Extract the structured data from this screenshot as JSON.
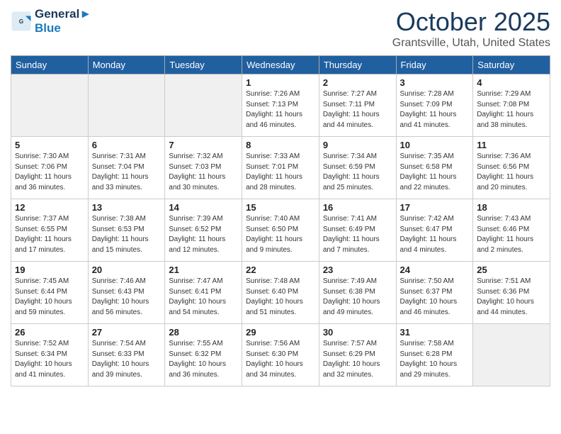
{
  "header": {
    "logo_line1": "General",
    "logo_line2": "Blue",
    "month": "October 2025",
    "location": "Grantsville, Utah, United States"
  },
  "weekdays": [
    "Sunday",
    "Monday",
    "Tuesday",
    "Wednesday",
    "Thursday",
    "Friday",
    "Saturday"
  ],
  "weeks": [
    [
      {
        "day": "",
        "info": "",
        "empty": true
      },
      {
        "day": "",
        "info": "",
        "empty": true
      },
      {
        "day": "",
        "info": "",
        "empty": true
      },
      {
        "day": "1",
        "info": "Sunrise: 7:26 AM\nSunset: 7:13 PM\nDaylight: 11 hours\nand 46 minutes.",
        "empty": false
      },
      {
        "day": "2",
        "info": "Sunrise: 7:27 AM\nSunset: 7:11 PM\nDaylight: 11 hours\nand 44 minutes.",
        "empty": false
      },
      {
        "day": "3",
        "info": "Sunrise: 7:28 AM\nSunset: 7:09 PM\nDaylight: 11 hours\nand 41 minutes.",
        "empty": false
      },
      {
        "day": "4",
        "info": "Sunrise: 7:29 AM\nSunset: 7:08 PM\nDaylight: 11 hours\nand 38 minutes.",
        "empty": false
      }
    ],
    [
      {
        "day": "5",
        "info": "Sunrise: 7:30 AM\nSunset: 7:06 PM\nDaylight: 11 hours\nand 36 minutes.",
        "empty": false
      },
      {
        "day": "6",
        "info": "Sunrise: 7:31 AM\nSunset: 7:04 PM\nDaylight: 11 hours\nand 33 minutes.",
        "empty": false
      },
      {
        "day": "7",
        "info": "Sunrise: 7:32 AM\nSunset: 7:03 PM\nDaylight: 11 hours\nand 30 minutes.",
        "empty": false
      },
      {
        "day": "8",
        "info": "Sunrise: 7:33 AM\nSunset: 7:01 PM\nDaylight: 11 hours\nand 28 minutes.",
        "empty": false
      },
      {
        "day": "9",
        "info": "Sunrise: 7:34 AM\nSunset: 6:59 PM\nDaylight: 11 hours\nand 25 minutes.",
        "empty": false
      },
      {
        "day": "10",
        "info": "Sunrise: 7:35 AM\nSunset: 6:58 PM\nDaylight: 11 hours\nand 22 minutes.",
        "empty": false
      },
      {
        "day": "11",
        "info": "Sunrise: 7:36 AM\nSunset: 6:56 PM\nDaylight: 11 hours\nand 20 minutes.",
        "empty": false
      }
    ],
    [
      {
        "day": "12",
        "info": "Sunrise: 7:37 AM\nSunset: 6:55 PM\nDaylight: 11 hours\nand 17 minutes.",
        "empty": false
      },
      {
        "day": "13",
        "info": "Sunrise: 7:38 AM\nSunset: 6:53 PM\nDaylight: 11 hours\nand 15 minutes.",
        "empty": false
      },
      {
        "day": "14",
        "info": "Sunrise: 7:39 AM\nSunset: 6:52 PM\nDaylight: 11 hours\nand 12 minutes.",
        "empty": false
      },
      {
        "day": "15",
        "info": "Sunrise: 7:40 AM\nSunset: 6:50 PM\nDaylight: 11 hours\nand 9 minutes.",
        "empty": false
      },
      {
        "day": "16",
        "info": "Sunrise: 7:41 AM\nSunset: 6:49 PM\nDaylight: 11 hours\nand 7 minutes.",
        "empty": false
      },
      {
        "day": "17",
        "info": "Sunrise: 7:42 AM\nSunset: 6:47 PM\nDaylight: 11 hours\nand 4 minutes.",
        "empty": false
      },
      {
        "day": "18",
        "info": "Sunrise: 7:43 AM\nSunset: 6:46 PM\nDaylight: 11 hours\nand 2 minutes.",
        "empty": false
      }
    ],
    [
      {
        "day": "19",
        "info": "Sunrise: 7:45 AM\nSunset: 6:44 PM\nDaylight: 10 hours\nand 59 minutes.",
        "empty": false
      },
      {
        "day": "20",
        "info": "Sunrise: 7:46 AM\nSunset: 6:43 PM\nDaylight: 10 hours\nand 56 minutes.",
        "empty": false
      },
      {
        "day": "21",
        "info": "Sunrise: 7:47 AM\nSunset: 6:41 PM\nDaylight: 10 hours\nand 54 minutes.",
        "empty": false
      },
      {
        "day": "22",
        "info": "Sunrise: 7:48 AM\nSunset: 6:40 PM\nDaylight: 10 hours\nand 51 minutes.",
        "empty": false
      },
      {
        "day": "23",
        "info": "Sunrise: 7:49 AM\nSunset: 6:38 PM\nDaylight: 10 hours\nand 49 minutes.",
        "empty": false
      },
      {
        "day": "24",
        "info": "Sunrise: 7:50 AM\nSunset: 6:37 PM\nDaylight: 10 hours\nand 46 minutes.",
        "empty": false
      },
      {
        "day": "25",
        "info": "Sunrise: 7:51 AM\nSunset: 6:36 PM\nDaylight: 10 hours\nand 44 minutes.",
        "empty": false
      }
    ],
    [
      {
        "day": "26",
        "info": "Sunrise: 7:52 AM\nSunset: 6:34 PM\nDaylight: 10 hours\nand 41 minutes.",
        "empty": false
      },
      {
        "day": "27",
        "info": "Sunrise: 7:54 AM\nSunset: 6:33 PM\nDaylight: 10 hours\nand 39 minutes.",
        "empty": false
      },
      {
        "day": "28",
        "info": "Sunrise: 7:55 AM\nSunset: 6:32 PM\nDaylight: 10 hours\nand 36 minutes.",
        "empty": false
      },
      {
        "day": "29",
        "info": "Sunrise: 7:56 AM\nSunset: 6:30 PM\nDaylight: 10 hours\nand 34 minutes.",
        "empty": false
      },
      {
        "day": "30",
        "info": "Sunrise: 7:57 AM\nSunset: 6:29 PM\nDaylight: 10 hours\nand 32 minutes.",
        "empty": false
      },
      {
        "day": "31",
        "info": "Sunrise: 7:58 AM\nSunset: 6:28 PM\nDaylight: 10 hours\nand 29 minutes.",
        "empty": false
      },
      {
        "day": "",
        "info": "",
        "empty": true
      }
    ]
  ]
}
